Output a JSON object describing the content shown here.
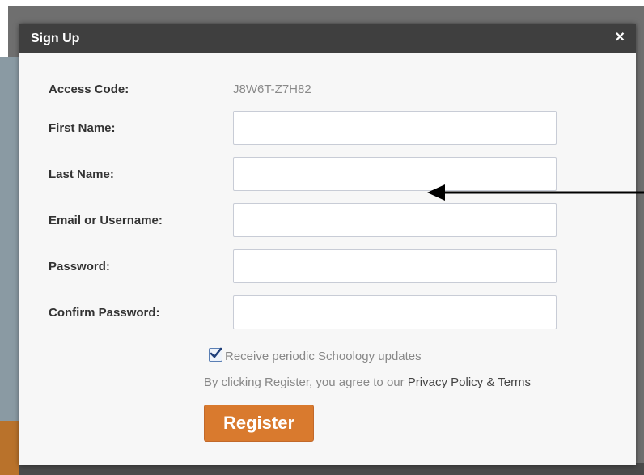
{
  "modal": {
    "title": "Sign Up",
    "close_label": "×"
  },
  "form": {
    "access_code": {
      "label": "Access Code:",
      "value": "J8W6T-Z7H82"
    },
    "first_name": {
      "label": "First Name:",
      "value": ""
    },
    "last_name": {
      "label": "Last Name:",
      "value": ""
    },
    "email": {
      "label": "Email or Username:",
      "value": ""
    },
    "password": {
      "label": "Password:",
      "value": ""
    },
    "confirm_password": {
      "label": "Confirm Password:",
      "value": ""
    },
    "updates_checkbox": {
      "label": "Receive periodic Schoology updates",
      "checked": true
    },
    "terms": {
      "prefix": "By clicking Register, you agree to our ",
      "link": "Privacy Policy & Terms"
    },
    "register_label": "Register"
  },
  "annotation": {
    "icon": "arrow-left-icon",
    "color": "#000000"
  },
  "colors": {
    "header": "#3f3f3f",
    "accent": "#d97a2e",
    "modal_bg": "#f7f7f7"
  }
}
